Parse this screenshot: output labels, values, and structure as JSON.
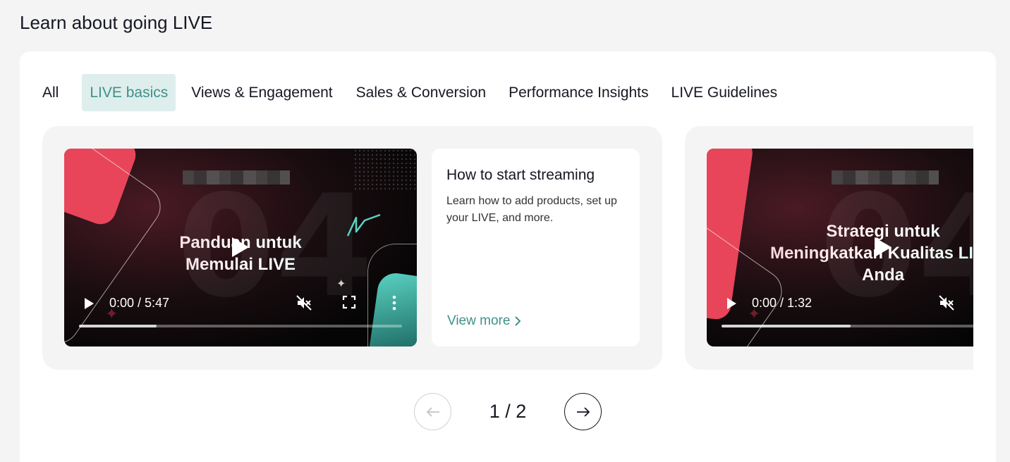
{
  "page": {
    "title": "Learn about going LIVE"
  },
  "tabs": [
    {
      "label": "All",
      "active": false
    },
    {
      "label": "LIVE basics",
      "active": true
    },
    {
      "label": "Views & Engagement",
      "active": false
    },
    {
      "label": "Sales & Conversion",
      "active": false
    },
    {
      "label": "Performance Insights",
      "active": false
    },
    {
      "label": "LIVE Guidelines",
      "active": false
    }
  ],
  "cards": [
    {
      "video": {
        "title_line1": "Panduan untuk",
        "title_line2": "Memulai LIVE",
        "time": "0:00 / 5:47",
        "buffered_fraction": 0.24,
        "muted": true
      },
      "info": {
        "title": "How to start streaming",
        "description": "Learn how to add products, set up your LIVE, and more.",
        "link": "View more"
      }
    },
    {
      "video": {
        "title_line1": "Strategi untuk",
        "title_line2": "Meningkatkan Kualitas LIVE",
        "title_line3": "Anda",
        "time": "0:00 / 1:32",
        "buffered_fraction": 0.4,
        "muted": true
      }
    }
  ],
  "pager": {
    "text": "1 / 2"
  },
  "colors": {
    "accent": "#3f918a",
    "accent_bg": "#deeeec",
    "brand_pink": "#e8455a",
    "brand_teal": "#5ad3c2"
  }
}
